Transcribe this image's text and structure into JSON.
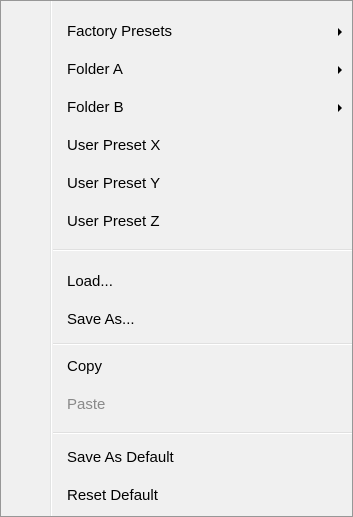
{
  "menu": {
    "items": [
      {
        "label": "Factory Presets",
        "submenu": true,
        "enabled": true
      },
      {
        "label": "Folder A",
        "submenu": true,
        "enabled": true
      },
      {
        "label": "Folder B",
        "submenu": true,
        "enabled": true
      },
      {
        "label": "User Preset X",
        "submenu": false,
        "enabled": true
      },
      {
        "label": "User Preset Y",
        "submenu": false,
        "enabled": true
      },
      {
        "label": "User Preset Z",
        "submenu": false,
        "enabled": true
      },
      {
        "label": "Load...",
        "submenu": false,
        "enabled": true
      },
      {
        "label": "Save As...",
        "submenu": false,
        "enabled": true
      },
      {
        "label": "Copy",
        "submenu": false,
        "enabled": true
      },
      {
        "label": "Paste",
        "submenu": false,
        "enabled": false
      },
      {
        "label": "Save As Default",
        "submenu": false,
        "enabled": true
      },
      {
        "label": "Reset Default",
        "submenu": false,
        "enabled": true
      }
    ]
  },
  "colors": {
    "background": "#f0f0f0",
    "border": "#979797",
    "text": "#000000",
    "disabled_text": "#8a8a8a"
  },
  "icons": {
    "submenu_arrow": "submenu-arrow-icon"
  }
}
